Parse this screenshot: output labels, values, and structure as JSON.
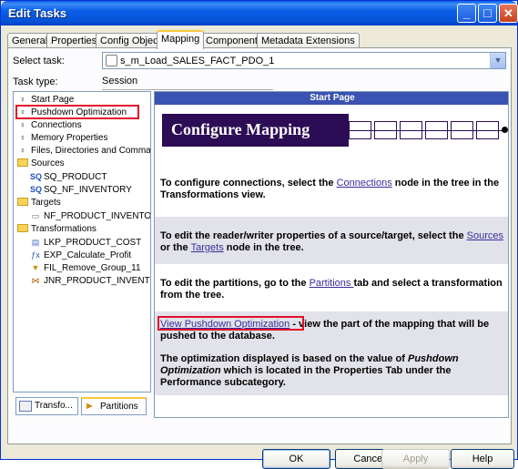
{
  "window": {
    "title": "Edit Tasks"
  },
  "tabs": [
    "General",
    "Properties",
    "Config Object",
    "Mapping",
    "Components",
    "Metadata Extensions"
  ],
  "active_tab": "Mapping",
  "select_task": {
    "label": "Select task:",
    "value": "s_m_Load_SALES_FACT_PDO_1"
  },
  "task_type": {
    "label": "Task type:",
    "value": "Session"
  },
  "tree": {
    "items": [
      {
        "label": "Start Page",
        "icon": "node-icon"
      },
      {
        "label": "Pushdown Optimization",
        "icon": "node-icon"
      },
      {
        "label": "Connections",
        "icon": "node-icon"
      },
      {
        "label": "Memory Properties",
        "icon": "node-icon"
      },
      {
        "label": "Files, Directories and Commar",
        "icon": "node-icon"
      },
      {
        "label": "Sources",
        "icon": "folder-icon"
      },
      {
        "label": "SQ_PRODUCT",
        "icon": "source-qualifier-icon"
      },
      {
        "label": "SQ_NF_INVENTORY",
        "icon": "source-qualifier-icon"
      },
      {
        "label": "Targets",
        "icon": "folder-icon"
      },
      {
        "label": "NF_PRODUCT_INVENTOR",
        "icon": "target-icon"
      },
      {
        "label": "Transformations",
        "icon": "folder-icon"
      },
      {
        "label": "LKP_PRODUCT_COST",
        "icon": "lookup-icon"
      },
      {
        "label": "EXP_Calculate_Profit",
        "icon": "expression-icon"
      },
      {
        "label": "FIL_Remove_Group_11",
        "icon": "filter-icon"
      },
      {
        "label": "JNR_PRODUCT_INVENTO",
        "icon": "joiner-icon"
      }
    ]
  },
  "bottom_tabs": [
    "Transfo...",
    "Partitions"
  ],
  "content": {
    "header": "Start Page",
    "banner": "Configure Mapping",
    "sections": {
      "s1_pre": "To configure connections, select the ",
      "s1_link": "Connections",
      "s1_post": " node in the tree in the Transformations view.",
      "s2_pre": "To edit the reader/writer properties of a source/target, select the ",
      "s2_link1": "Sources",
      "s2_mid": " or the ",
      "s2_link2": "Targets",
      "s2_post": " node in the tree.",
      "s3_pre": "To edit the partitions, go to the ",
      "s3_link": "Partitions ",
      "s3_post": "tab and select a transformation from the tree.",
      "s4_link": "View Pushdown Optimization",
      "s4_post": " - view the part of the mapping that will be pushed to the database.",
      "s5_pre": "The optimization displayed is based on the value of ",
      "s5_italic": "Pushdown Optimization",
      "s5_post": " which is located in the Properties Tab under the Performance subcategory."
    }
  },
  "buttons": {
    "ok": "OK",
    "cancel": "Cancel",
    "apply": "Apply",
    "help": "Help"
  },
  "colors": {
    "title_bar": "#0a5ee8",
    "banner": "#2c0d55",
    "link": "#3b2b9a",
    "highlight": "#e0102a"
  }
}
